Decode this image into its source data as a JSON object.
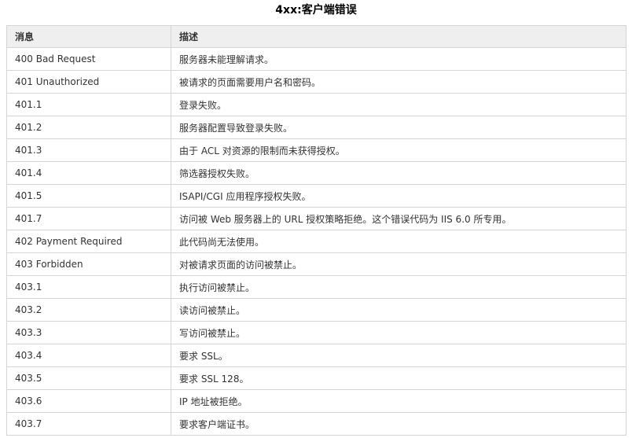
{
  "title": "4xx:客户端错误",
  "table": {
    "headers": [
      "消息",
      "描述"
    ],
    "rows": [
      [
        "400 Bad Request",
        "服务器未能理解请求。"
      ],
      [
        "401 Unauthorized",
        "被请求的页面需要用户名和密码。"
      ],
      [
        "401.1",
        "登录失败。"
      ],
      [
        "401.2",
        "服务器配置导致登录失败。"
      ],
      [
        "401.3",
        "由于 ACL 对资源的限制而未获得授权。"
      ],
      [
        "401.4",
        "筛选器授权失败。"
      ],
      [
        "401.5",
        "ISAPI/CGI 应用程序授权失败。"
      ],
      [
        "401.7",
        "访问被 Web 服务器上的 URL 授权策略拒绝。这个错误代码为 IIS 6.0 所专用。"
      ],
      [
        "402 Payment Required",
        "此代码尚无法使用。"
      ],
      [
        "403 Forbidden",
        "对被请求页面的访问被禁止。"
      ],
      [
        "403.1",
        "执行访问被禁止。"
      ],
      [
        "403.2",
        "读访问被禁止。"
      ],
      [
        "403.3",
        "写访问被禁止。"
      ],
      [
        "403.4",
        "要求 SSL。"
      ],
      [
        "403.5",
        "要求 SSL 128。"
      ],
      [
        "403.6",
        "IP 地址被拒绝。"
      ],
      [
        "403.7",
        "要求客户端证书。"
      ]
    ]
  }
}
